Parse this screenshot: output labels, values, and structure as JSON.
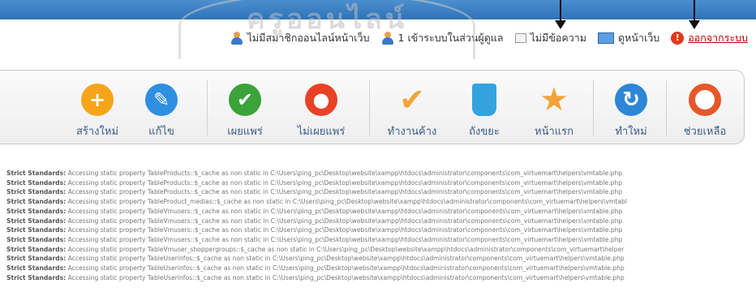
{
  "status": {
    "online_users": "ไม่มีสมาชิกออนไลน์หน้าเว็บ",
    "admin_login": "1 เข้าระบบในส่วนผู้ดูแล",
    "messages": "ไม่มีข้อความ",
    "view_site": "ดูหน้าเว็บ",
    "logout": "ออกจากระบบ"
  },
  "toolbar": {
    "buttons": [
      {
        "label": "สร้างใหม่",
        "icon": "plus-icon",
        "color": "#f6a51b",
        "glyph": "+"
      },
      {
        "label": "แก้ไข",
        "icon": "pencil-icon",
        "color": "#2f8fe0",
        "glyph": "✎"
      },
      {
        "label": "เผยแพร่",
        "icon": "check-icon",
        "color": "#3aa339",
        "glyph": "✔"
      },
      {
        "label": "ไม่เผยแพร่",
        "icon": "stop-icon",
        "color": "#e94125",
        "glyph": "●"
      },
      {
        "label": "ทำงานค้าง",
        "icon": "checkmark-icon",
        "color": "#f2a53a",
        "glyph": "✔"
      },
      {
        "label": "ถังขยะ",
        "icon": "trash-icon",
        "color": "#34a3dd",
        "glyph": "🗑"
      },
      {
        "label": "หน้าแรก",
        "icon": "star-icon",
        "color": "#f3a33a",
        "glyph": "★"
      },
      {
        "label": "ทำใหม่",
        "icon": "refresh-icon",
        "color": "#2e86d6",
        "glyph": "↻"
      },
      {
        "label": "ช่วยเหลือ",
        "icon": "lifebuoy-icon",
        "color": "#e5582a",
        "glyph": "⊕"
      }
    ]
  },
  "log": {
    "prefix": "Strict Standards:",
    "lines": [
      "Accessing static property TableProducts::$_cache as non static in C:\\Users\\ping_pc\\Desktop\\website\\xampp\\htdocs\\administrator\\components\\com_virtuemart\\helpers\\vmtable.php",
      "Accessing static property TableProducts::$_cache as non static in C:\\Users\\ping_pc\\Desktop\\website\\xampp\\htdocs\\administrator\\components\\com_virtuemart\\helpers\\vmtable.php",
      "Accessing static property TableProducts::$_cache as non static in C:\\Users\\ping_pc\\Desktop\\website\\xampp\\htdocs\\administrator\\components\\com_virtuemart\\helpers\\vmtable.php",
      "Accessing static property TableProduct_medias::$_cache as non static in C:\\Users\\ping_pc\\Desktop\\website\\xampp\\htdocs\\administrator\\components\\com_virtuemart\\helpers\\vmtabl",
      "Accessing static property TableVmusers::$_cache as non static in C:\\Users\\ping_pc\\Desktop\\website\\xampp\\htdocs\\administrator\\components\\com_virtuemart\\helpers\\vmtable.php",
      "Accessing static property TableVmusers::$_cache as non static in C:\\Users\\ping_pc\\Desktop\\website\\xampp\\htdocs\\administrator\\components\\com_virtuemart\\helpers\\vmtable.php",
      "Accessing static property TableVmusers::$_cache as non static in C:\\Users\\ping_pc\\Desktop\\website\\xampp\\htdocs\\administrator\\components\\com_virtuemart\\helpers\\vmtable.php",
      "Accessing static property TableVmusers::$_cache as non static in C:\\Users\\ping_pc\\Desktop\\website\\xampp\\htdocs\\administrator\\components\\com_virtuemart\\helpers\\vmtable.php",
      "Accessing static property TableVmuser_shoppergroups::$_cache as non static in C:\\Users\\ping_pc\\Desktop\\website\\xampp\\htdocs\\administrator\\components\\com_virtuemart\\helper",
      "Accessing static property TableUserinfos::$_cache as non static in C:\\Users\\ping_pc\\Desktop\\website\\xampp\\htdocs\\administrator\\components\\com_virtuemart\\helpers\\vmtable.php",
      "Accessing static property TableUserinfos::$_cache as non static in C:\\Users\\ping_pc\\Desktop\\website\\xampp\\htdocs\\administrator\\components\\com_virtuemart\\helpers\\vmtable.php",
      "Accessing static property TableUserinfos::$_cache as non static in C:\\Users\\ping_pc\\Desktop\\website\\xampp\\htdocs\\administrator\\components\\com_virtuemart\\helpers\\vmtable.php"
    ]
  }
}
